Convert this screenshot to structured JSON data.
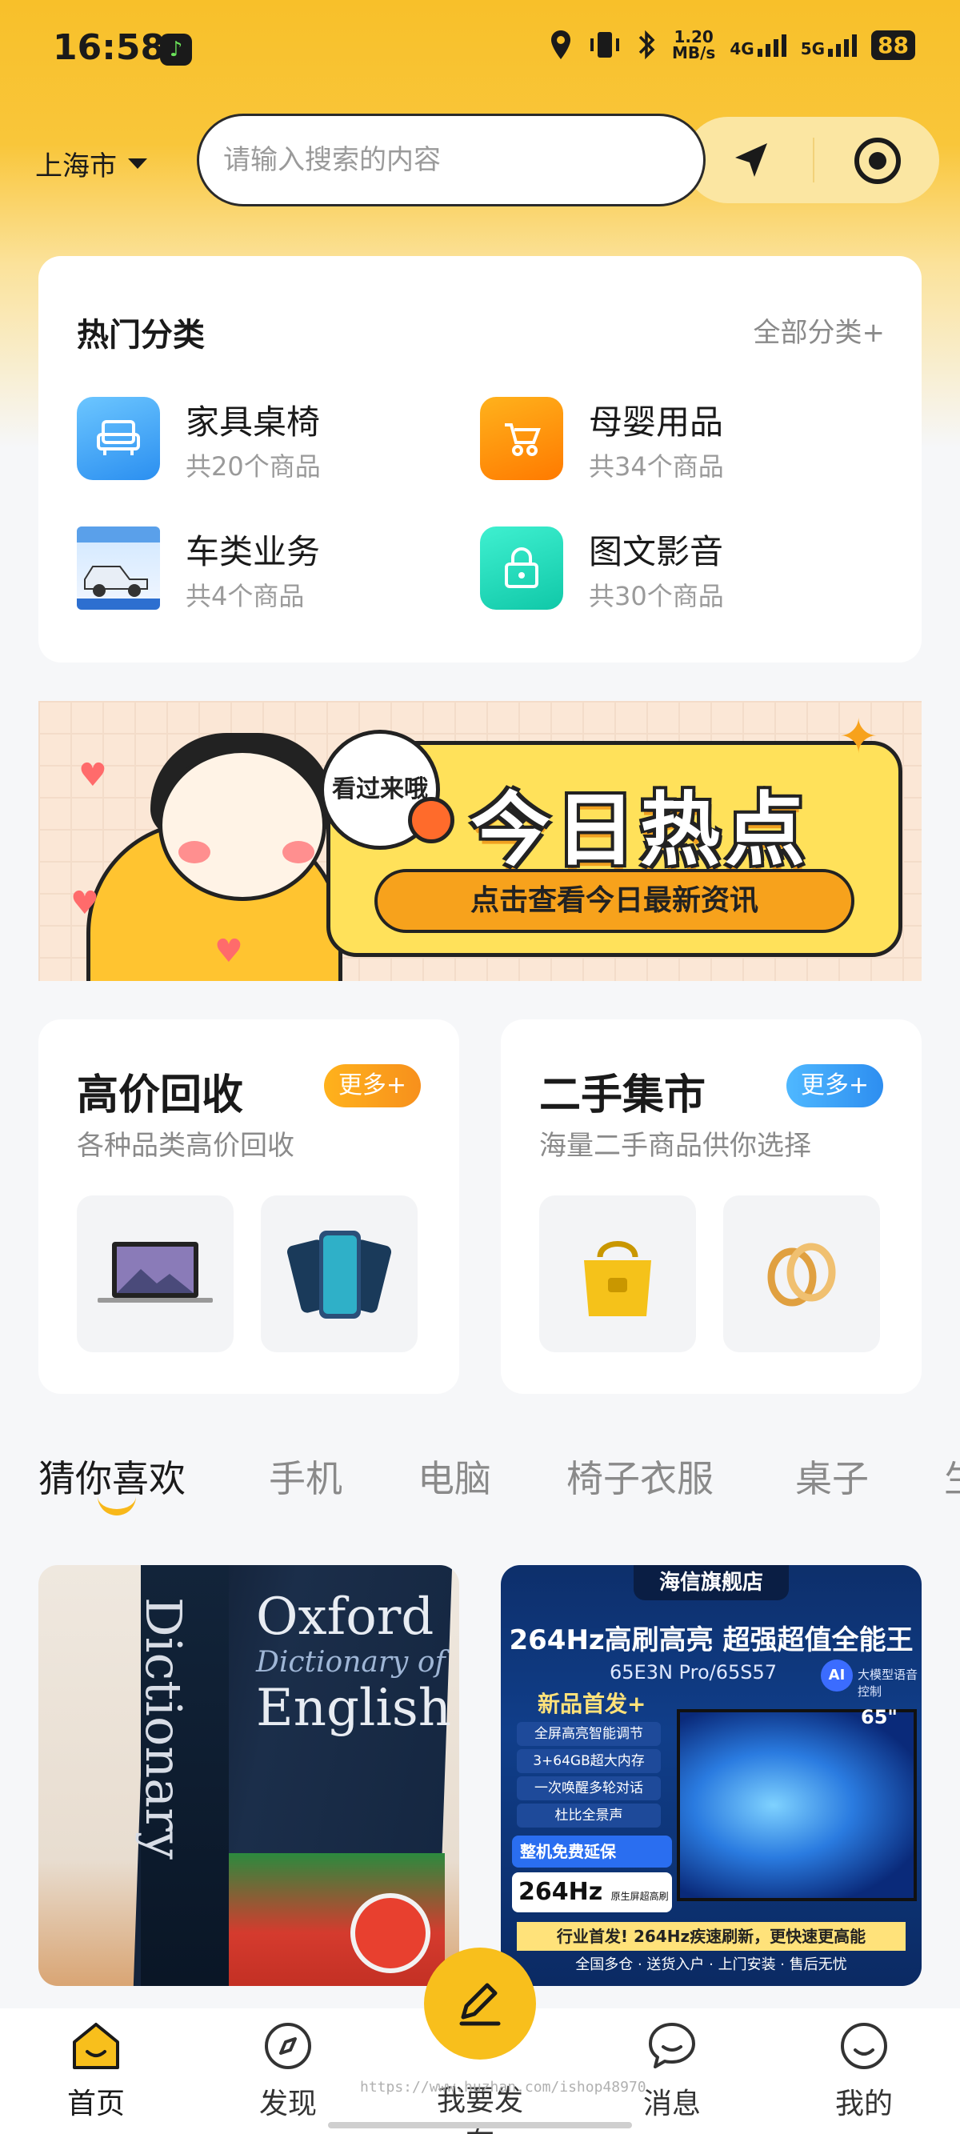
{
  "status_bar": {
    "time": "16:58",
    "net_speed": "1.20",
    "net_unit": "MB/s",
    "sig1": "4G",
    "sig2": "5G",
    "battery": "88"
  },
  "search": {
    "city": "上海市",
    "placeholder": "请输入搜索的内容"
  },
  "categories": {
    "title": "热门分类",
    "all_label": "全部分类+",
    "items": [
      {
        "name": "家具桌椅",
        "count": "共20个商品"
      },
      {
        "name": "母婴用品",
        "count": "共34个商品"
      },
      {
        "name": "车类业务",
        "count": "共4个商品"
      },
      {
        "name": "图文影音",
        "count": "共30个商品"
      }
    ]
  },
  "banner": {
    "bubble": "看过来哦",
    "title": "今日热点",
    "pill": "点击查看今日最新资讯"
  },
  "recycle": {
    "title": "高价回收",
    "more": "更多+",
    "subtitle": "各种品类高价回收"
  },
  "market": {
    "title": "二手集市",
    "more": "更多+",
    "subtitle": "海量二手商品供你选择"
  },
  "tabs": [
    "猜你喜欢",
    "手机",
    "电脑",
    "椅子衣服",
    "桌子",
    "生"
  ],
  "products": {
    "dict": {
      "spine": "Dictionary",
      "title1": "Oxford",
      "title2": "Dictionary of",
      "title3": "English"
    },
    "tv": {
      "store": "海信旗舰店",
      "headline": "264Hz高刷高亮 超强超值全能王",
      "model": "65E3N Pro/65S57",
      "ai": "AI",
      "ai_text": "大模型语音控制",
      "new": "新品首发+",
      "features": [
        "全屏高亮智能调节",
        "3+64GB超大内存",
        "一次唤醒多轮对话",
        "杜比全景声"
      ],
      "size": "65\"",
      "warranty": "整机免费延保",
      "hz": "264Hz",
      "hz_note": "原生屏超高刷新",
      "footer1": "行业首发! 264Hz疾速刷新，更快速更高能",
      "footer2": "全国多仓 · 送货入户 · 上门安装 · 售后无忧"
    }
  },
  "bottom_nav": [
    "首页",
    "发现",
    "我要发布",
    "消息",
    "我的"
  ],
  "watermark": "https://www.huzhan.com/ishop48970",
  "colors": {
    "brand": "#f8bf1c",
    "more_orange": "#f7a21c",
    "more_blue": "#3aa3f5"
  }
}
